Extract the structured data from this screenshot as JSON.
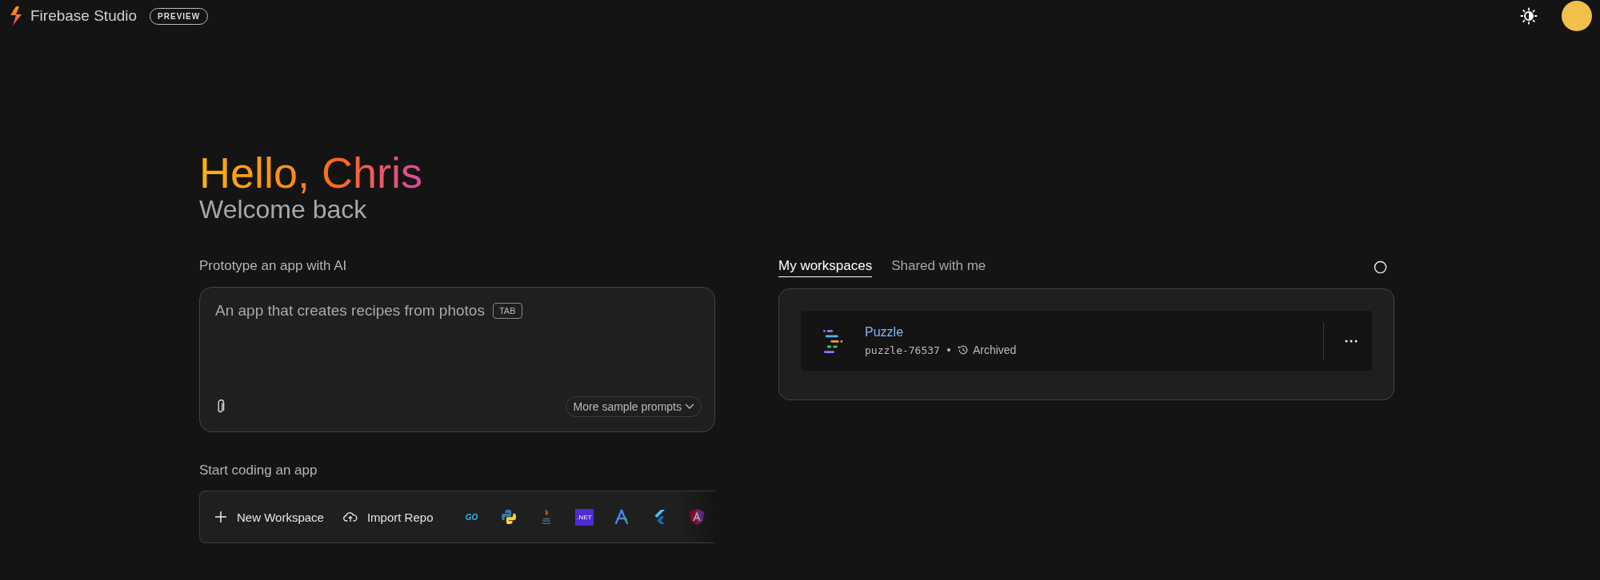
{
  "header": {
    "title": "Firebase Studio",
    "badge": "PREVIEW"
  },
  "greeting": {
    "title": "Hello, Chris",
    "subtitle": "Welcome back"
  },
  "prototype": {
    "label": "Prototype an app with AI",
    "placeholder": "An app that creates recipes from photos",
    "key_hint": "TAB",
    "more_button": "More sample prompts"
  },
  "coding": {
    "label": "Start coding an app",
    "actions": [
      {
        "kind": "new",
        "label": "New Workspace"
      },
      {
        "kind": "import",
        "label": "Import Repo"
      }
    ],
    "templates": [
      {
        "kind": "go",
        "label": "GO"
      },
      {
        "kind": "python"
      },
      {
        "kind": "java"
      },
      {
        "kind": "dotnet",
        "label": ".NET"
      },
      {
        "kind": "compass"
      },
      {
        "kind": "flutter"
      },
      {
        "kind": "angular"
      }
    ]
  },
  "workspaces": {
    "tabs": [
      {
        "label": "My workspaces",
        "selected": true
      },
      {
        "label": "Shared with me",
        "selected": false
      }
    ],
    "items": [
      {
        "name": "Puzzle",
        "id": "puzzle-76537",
        "status": "Archived"
      }
    ]
  }
}
